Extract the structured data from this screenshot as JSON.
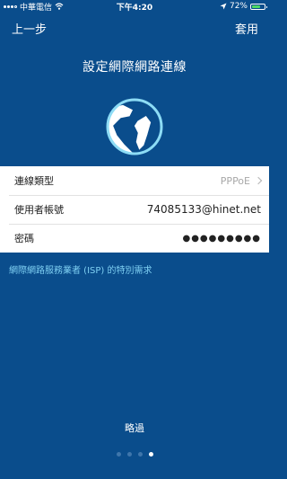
{
  "status_bar": {
    "carrier": "中華電信",
    "time": "下午4:20",
    "battery": "72%",
    "battery_level": 0.72
  },
  "nav": {
    "back_label": "上一步",
    "apply_label": "套用"
  },
  "title": "設定網際網路連線",
  "form": {
    "connection_type": {
      "label": "連線類型",
      "value": "PPPoE"
    },
    "username": {
      "label": "使用者帳號",
      "value": "74085133@hinet.net"
    },
    "password": {
      "label": "密碼",
      "value": "●●●●●●●●●"
    }
  },
  "isp_link": "網際網路服務業者 (ISP) 的特別需求",
  "skip_label": "略過",
  "pager": {
    "total": 4,
    "current": 4
  },
  "colors": {
    "background": "#0a4d8c",
    "accent": "#7fd0f3",
    "globe": "#8ddcf5"
  }
}
